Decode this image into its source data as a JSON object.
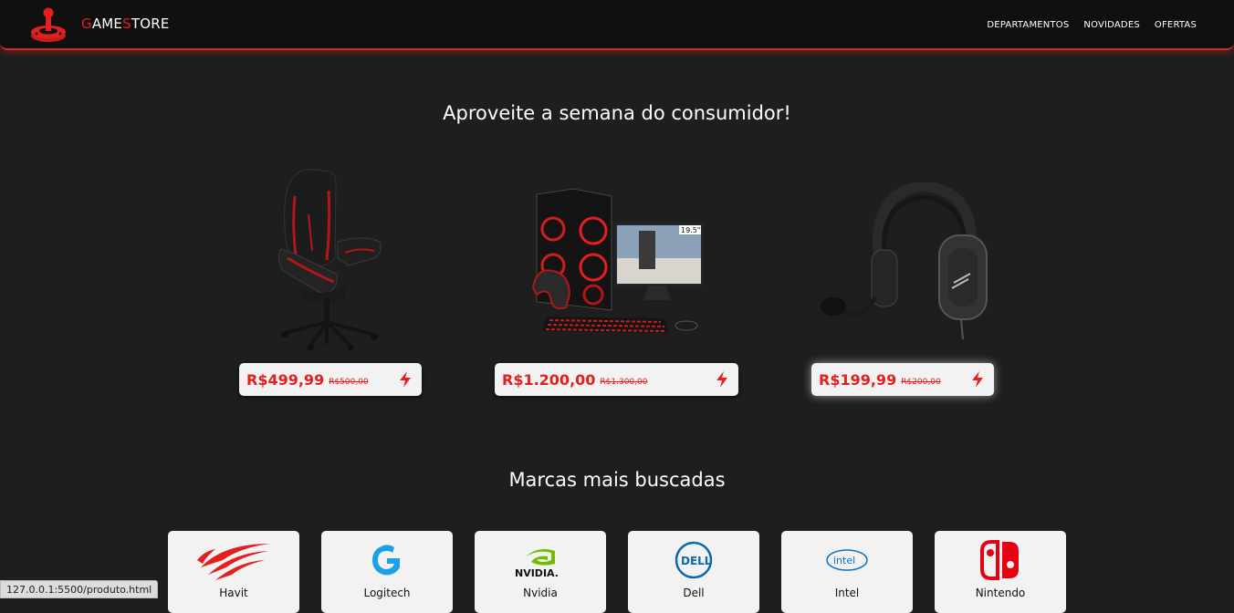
{
  "header": {
    "brand_first": "G",
    "brand_mid": "AME",
    "brand_s": "S",
    "brand_rest": "TORE",
    "nav": [
      "DEPARTAMENTOS",
      "NOVIDADES",
      "OFERTAS"
    ]
  },
  "promo": {
    "title": "Aproveite a semana do consumidor!",
    "products": [
      {
        "price": "R$499,99",
        "old_price": "R$500,00"
      },
      {
        "price": "R$1.200,00",
        "old_price": "R$1.300,00"
      },
      {
        "price": "R$199,99",
        "old_price": "R$200,00"
      }
    ]
  },
  "brands": {
    "title": "Marcas mais buscadas",
    "items": [
      "Havit",
      "Logitech",
      "Nvidia",
      "Dell",
      "Intel",
      "Nintendo"
    ]
  },
  "status_bar": {
    "url": "127.0.0.1:5500/produto.html"
  },
  "colors": {
    "accent": "#e41f1f",
    "background": "#1e1e1e",
    "card": "#f2f2f2"
  }
}
